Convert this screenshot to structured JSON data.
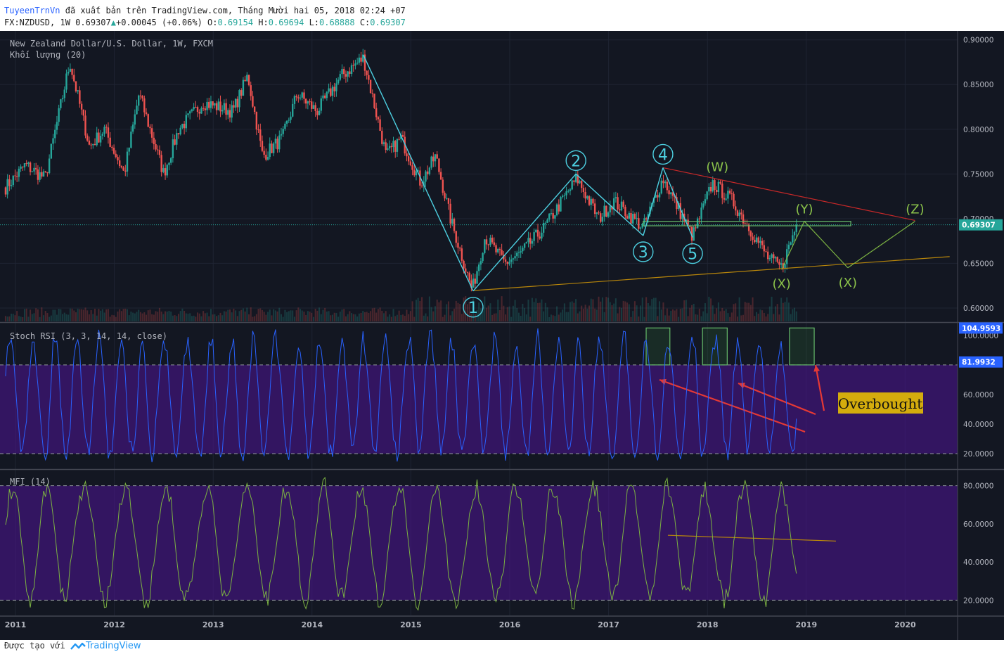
{
  "header": {
    "author": "TuyeenTrnVn",
    "published": "đã xuất bản trên TradingView.com, Tháng Mười hai 05, 2018 02:24 +07",
    "symbol": "FX:NZDUSD, 1W",
    "last": "0.69307",
    "change": "+0.00045 (+0.06%)",
    "o_label": "O:",
    "o": "0.69154",
    "h_label": "H:",
    "h": "0.69694",
    "l_label": "L:",
    "l": "0.68888",
    "c_label": "C:",
    "c": "0.69307"
  },
  "footer": {
    "made_with": "Được tạo với",
    "brand": "TradingView"
  },
  "colors": {
    "background": "#131722",
    "bull": "#26a69a",
    "bear": "#ef5350",
    "wave": "#4dd0e1",
    "stoch": "#2962ff",
    "mfi": "#7cb342",
    "band": "#4a148c",
    "trend_red": "#c62828",
    "trend_gold": "#b8860b",
    "price_label": "#26a69a",
    "overbought_bg": "#d4ac0d"
  },
  "chart_data": [
    {
      "type": "candlestick",
      "title": "New Zealand Dollar/U.S. Dollar, 1W, FXCM",
      "volume_label": "Khối lượng (20)",
      "x_ticks": [
        "2011",
        "2012",
        "2013",
        "2014",
        "2015",
        "2016",
        "2017",
        "2018",
        "2019",
        "2020"
      ],
      "y_ticks": [
        "0.90000",
        "0.85000",
        "0.80000",
        "0.75000",
        "0.70000",
        "0.65000",
        "0.60000"
      ],
      "ylim": [
        0.585,
        0.91
      ],
      "last_price": 0.69307,
      "last_price_label": "0.69307",
      "key_points": [
        {
          "x": 2010.9,
          "y": 0.735
        },
        {
          "x": 2011.1,
          "y": 0.76
        },
        {
          "x": 2011.3,
          "y": 0.745
        },
        {
          "x": 2011.55,
          "y": 0.875
        },
        {
          "x": 2011.75,
          "y": 0.78
        },
        {
          "x": 2011.9,
          "y": 0.8
        },
        {
          "x": 2012.1,
          "y": 0.75
        },
        {
          "x": 2012.25,
          "y": 0.84
        },
        {
          "x": 2012.5,
          "y": 0.75
        },
        {
          "x": 2012.65,
          "y": 0.8
        },
        {
          "x": 2012.9,
          "y": 0.83
        },
        {
          "x": 2013.2,
          "y": 0.82
        },
        {
          "x": 2013.35,
          "y": 0.86
        },
        {
          "x": 2013.5,
          "y": 0.77
        },
        {
          "x": 2013.7,
          "y": 0.79
        },
        {
          "x": 2013.85,
          "y": 0.84
        },
        {
          "x": 2014.05,
          "y": 0.82
        },
        {
          "x": 2014.3,
          "y": 0.86
        },
        {
          "x": 2014.52,
          "y": 0.88
        },
        {
          "x": 2014.75,
          "y": 0.77
        },
        {
          "x": 2014.9,
          "y": 0.79
        },
        {
          "x": 2015.1,
          "y": 0.74
        },
        {
          "x": 2015.25,
          "y": 0.77
        },
        {
          "x": 2015.4,
          "y": 0.7
        },
        {
          "x": 2015.62,
          "y": 0.62
        },
        {
          "x": 2015.75,
          "y": 0.68
        },
        {
          "x": 2015.95,
          "y": 0.65
        },
        {
          "x": 2016.1,
          "y": 0.66
        },
        {
          "x": 2016.35,
          "y": 0.69
        },
        {
          "x": 2016.68,
          "y": 0.745
        },
        {
          "x": 2016.9,
          "y": 0.7
        },
        {
          "x": 2017.05,
          "y": 0.72
        },
        {
          "x": 2017.35,
          "y": 0.69
        },
        {
          "x": 2017.55,
          "y": 0.745
        },
        {
          "x": 2017.85,
          "y": 0.68
        },
        {
          "x": 2018.05,
          "y": 0.74
        },
        {
          "x": 2018.25,
          "y": 0.72
        },
        {
          "x": 2018.45,
          "y": 0.685
        },
        {
          "x": 2018.62,
          "y": 0.655
        },
        {
          "x": 2018.75,
          "y": 0.645
        },
        {
          "x": 2018.9,
          "y": 0.693
        }
      ],
      "annotations": [
        {
          "label": "1",
          "x": 2015.63,
          "y": 0.619,
          "style": "circle"
        },
        {
          "label": "2",
          "x": 2016.67,
          "y": 0.75,
          "style": "circle"
        },
        {
          "label": "3",
          "x": 2017.35,
          "y": 0.681,
          "style": "circle"
        },
        {
          "label": "4",
          "x": 2017.55,
          "y": 0.757,
          "style": "circle"
        },
        {
          "label": "5",
          "x": 2017.85,
          "y": 0.679,
          "style": "circle"
        },
        {
          "label": "(W)",
          "x": 2018.1,
          "y": 0.745,
          "style": "text"
        },
        {
          "label": "(X)",
          "x": 2018.75,
          "y": 0.643,
          "style": "text"
        },
        {
          "label": "(Y)",
          "x": 2018.98,
          "y": 0.698,
          "style": "text"
        },
        {
          "label": "(X)",
          "x": 2019.42,
          "y": 0.644,
          "style": "text"
        },
        {
          "label": "(Z)",
          "x": 2020.1,
          "y": 0.698,
          "style": "text"
        }
      ]
    },
    {
      "type": "line",
      "title": "Stoch RSI (3, 3, 14, 14, close)",
      "y_ticks": [
        "100.0000",
        "60.0000",
        "40.0000",
        "20.0000"
      ],
      "ylim": [
        10,
        108
      ],
      "band": [
        20,
        80
      ],
      "labels": [
        {
          "value": 104.9593,
          "text": "104.9593"
        },
        {
          "value": 81.9932,
          "text": "81.9932"
        }
      ],
      "callout": "Overbought"
    },
    {
      "type": "line",
      "title": "MFI (14)",
      "y_ticks": [
        "80.0000",
        "60.0000",
        "40.0000",
        "20.0000"
      ],
      "ylim": [
        12,
        88
      ],
      "band": [
        20,
        80
      ]
    }
  ]
}
